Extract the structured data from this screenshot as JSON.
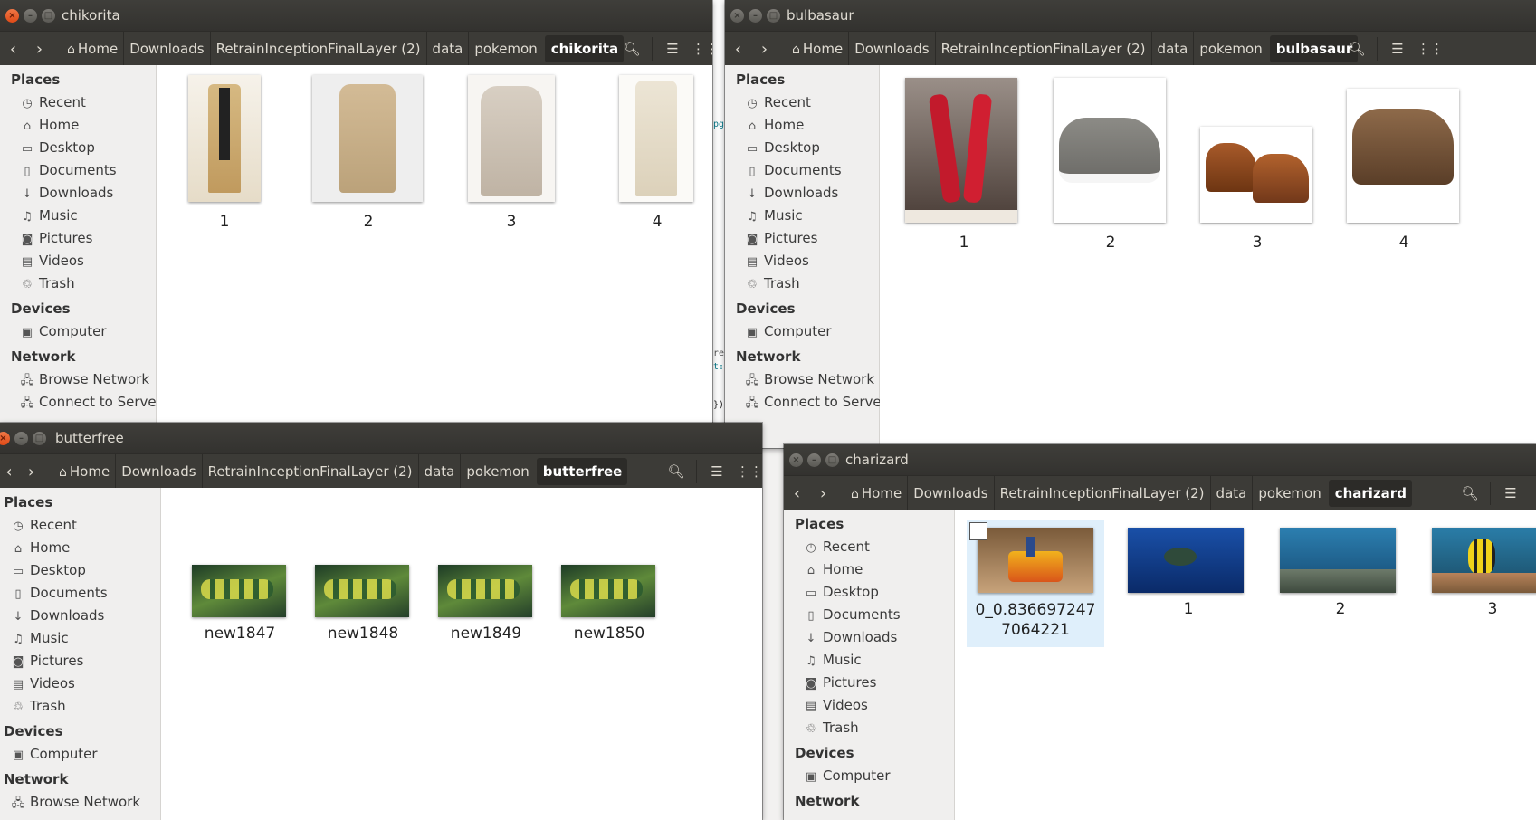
{
  "breadcrumb_parents": [
    "Home",
    "Downloads",
    "RetrainInceptionFinalLayer (2)",
    "data",
    "pokemon"
  ],
  "sidebar": {
    "places_heading": "Places",
    "places": [
      "Recent",
      "Home",
      "Desktop",
      "Documents",
      "Downloads",
      "Music",
      "Pictures",
      "Videos",
      "Trash"
    ],
    "devices_heading": "Devices",
    "devices": [
      "Computer"
    ],
    "network_heading": "Network",
    "network": [
      "Browse Network",
      "Connect to Server"
    ]
  },
  "windows": {
    "chikorita": {
      "title": "chikorita",
      "folder": "chikorita",
      "files": [
        "1",
        "2",
        "3",
        "4"
      ]
    },
    "bulbasaur": {
      "title": "bulbasaur",
      "folder": "bulbasaur",
      "files": [
        "1",
        "2",
        "3",
        "4"
      ]
    },
    "butterfree": {
      "title": "butterfree",
      "folder": "butterfree",
      "files": [
        "new1847",
        "new1848",
        "new1849",
        "new1850"
      ]
    },
    "charizard": {
      "title": "charizard",
      "folder": "charizard",
      "files": [
        "0_0.8366972477064221",
        "1",
        "2",
        "3"
      ]
    }
  },
  "background_code_fragments": [
    "pg",
    "re",
    "t:",
    "})",
    "de",
    "1]"
  ],
  "colors": {
    "titlebar": "#3c3b37",
    "toolbar": "#3c3b37",
    "close_button": "#e95420",
    "sidebar_bg": "#f0efee",
    "selected_bg": "#dfeffb"
  }
}
